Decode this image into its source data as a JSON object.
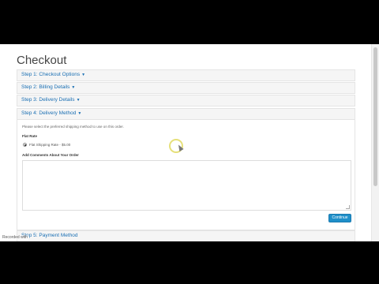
{
  "page": {
    "title": "Checkout"
  },
  "steps": [
    {
      "label": "Step 1: Checkout Options"
    },
    {
      "label": "Step 2: Billing Details"
    },
    {
      "label": "Step 3: Delivery Details"
    },
    {
      "label": "Step 4: Delivery Method"
    },
    {
      "label": "Step 5: Payment Method"
    }
  ],
  "delivery": {
    "instruction": "Please select the preferred shipping method to use on this order.",
    "rate_title": "Flat Rate",
    "rate_option": "Flat Shipping Rate - $5.00",
    "comments_label": "Add Comments About Your Order",
    "continue_label": "Continue"
  },
  "watermark": "Recorded with"
}
